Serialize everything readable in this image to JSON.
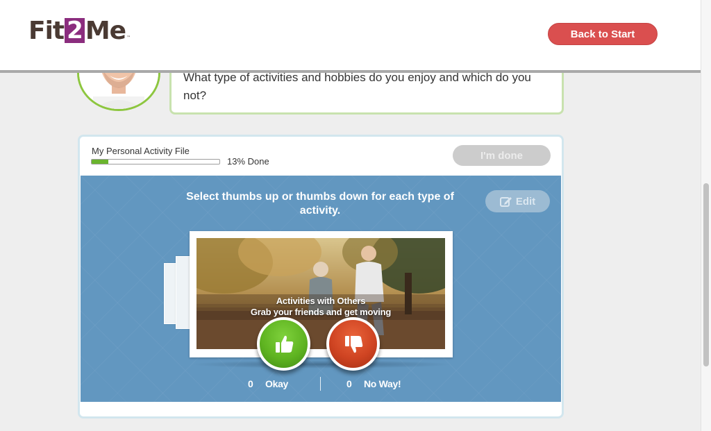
{
  "app": {
    "logo_pre": "Fit",
    "logo_num": "2",
    "logo_post": "Me",
    "logo_tm": "™"
  },
  "header": {
    "back_label": "Back to Start"
  },
  "coach": {
    "question": "What type of activities and hobbies do you enjoy and which do you not?"
  },
  "activity_file": {
    "title": "My Personal Activity File",
    "progress_percent": 13,
    "progress_label": "13% Done",
    "done_label": "I'm done"
  },
  "activity": {
    "instruction": "Select thumbs up or thumbs down for each type of activity.",
    "edit_label": "Edit",
    "card_title": "Activities with Others",
    "card_subtitle": "Grab your friends and get moving",
    "okay_count": "0",
    "okay_label": "Okay",
    "noway_count": "0",
    "noway_label": "No Way!"
  },
  "colors": {
    "brand_purple": "#8b2d7e",
    "back_button": "#da4f4f",
    "progress_green": "#6ab42d",
    "panel_blue": "#6297c0",
    "thumb_up": "#5fb421",
    "thumb_down": "#cf4422"
  },
  "icons": {
    "edit": "pencil-square-icon",
    "up": "thumbs-up-icon",
    "down": "thumbs-down-icon"
  }
}
